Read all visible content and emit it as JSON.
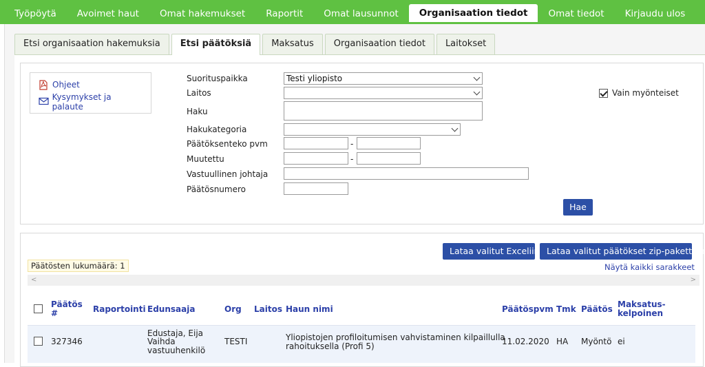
{
  "topnav": {
    "items": [
      "Työpöytä",
      "Avoimet haut",
      "Omat hakemukset",
      "Raportit",
      "Omat lausunnot",
      "Organisaation tiedot",
      "Omat tiedot",
      "Kirjaudu ulos"
    ],
    "active_index": 5
  },
  "subtabs": {
    "items": [
      "Etsi organisaation hakemuksia",
      "Etsi päätöksiä",
      "Maksatus",
      "Organisaation tiedot",
      "Laitokset"
    ],
    "active_index": 1
  },
  "help": {
    "ohjeet": "Ohjeet",
    "feedback": "Kysymykset ja palaute",
    "pdf_icon": "pdf-icon",
    "mail_icon": "envelope-icon"
  },
  "form": {
    "suorituspaikka_label": "Suorituspaikka",
    "suorituspaikka_value": "Testi yliopisto",
    "laitos_label": "Laitos",
    "laitos_value": "",
    "haku_label": "Haku",
    "hakukategoria_label": "Hakukategoria",
    "paatoksenteko_label": "Päätöksenteko pvm",
    "muutettu_label": "Muutettu",
    "vastuullinen_label": "Vastuullinen johtaja",
    "paatosnumero_label": "Päätösnumero",
    "dash": "-",
    "vain_myonteiset_label": "Vain myönteiset",
    "vain_myonteiset_checked": true,
    "search_button": "Hae"
  },
  "results": {
    "excel_button": "Lataa valitut Exceliin",
    "zip_button": "Lataa valitut päätökset zip-pakettina",
    "count_label": "Päätösten lukumäärä: 1",
    "show_all_columns": "Näytä kaikki sarakkeet",
    "columns": {
      "paatos_num_1": "Päätös",
      "paatos_num_2": "#",
      "raportointi": "Raportointi",
      "edunsaaja": "Edunsaaja",
      "org": "Org",
      "laitos": "Laitos",
      "haun_nimi": "Haun nimi",
      "paatospvm": "Päätöspvm",
      "tmk": "Tmk",
      "paatos": "Päätös",
      "maksatus_1": "Maksatus-",
      "maksatus_2": "kelpoinen"
    },
    "rows": [
      {
        "paatos_num": "327346",
        "edunsaaja": "Edustaja, Eija",
        "vaihda_1": "Vaihda",
        "vaihda_2": "vastuuhenkilö",
        "org": "TESTI",
        "haun_nimi_1": "Yliopistojen profiloitumisen vahvistaminen kilpaillulla",
        "haun_nimi_2": "rahoituksella (Profi 5)",
        "paatospvm": "11.02.2020",
        "tmk": "HA",
        "paatos": "Myöntö",
        "maksatuskelpoinen": "ei"
      }
    ]
  }
}
